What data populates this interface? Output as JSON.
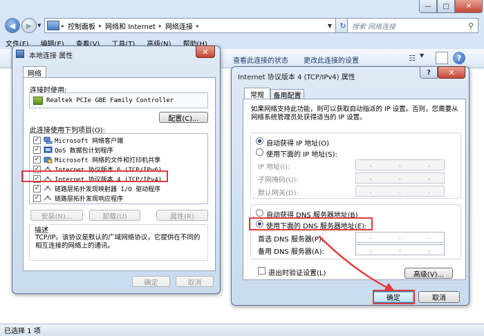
{
  "explorer": {
    "breadcrumb": [
      "控制面板",
      "网络和 Internet",
      "网络连接"
    ],
    "search_placeholder": "搜索 网络连接",
    "menu": [
      "文件(F)",
      "编辑(E)",
      "查看(V)",
      "工具(T)",
      "高级(N)",
      "帮助(H)"
    ],
    "commands": {
      "view_status": "查看此连接的状态",
      "change_settings": "更改此连接的设置"
    },
    "status": "已选择 1 项",
    "window_controls": {
      "minimize": "—",
      "maximize": "□",
      "close": "✕"
    }
  },
  "local_dialog": {
    "title": "本地连接 属性",
    "tab": "网络",
    "connect_using_label": "连接时使用:",
    "adapter": "Realtek PCIe GBE Family Controller",
    "configure_button": "配置(C)...",
    "items_label": "此连接使用下列项目(O):",
    "items": [
      {
        "label": "Microsoft 网络客户端",
        "checked": true,
        "icon": "network-client-icon"
      },
      {
        "label": "QoS 数据包计划程序",
        "checked": true,
        "icon": "qos-icon"
      },
      {
        "label": "Microsoft 网络的文件和打印机共享",
        "checked": true,
        "icon": "file-share-icon"
      },
      {
        "label": "Internet 协议版本 6 (TCP/IPv6)",
        "checked": true,
        "icon": "protocol-icon"
      },
      {
        "label": "Internet 协议版本 4 (TCP/IPv4)",
        "checked": true,
        "icon": "protocol-icon"
      },
      {
        "label": "链路层拓扑发现映射器 I/O 驱动程序",
        "checked": true,
        "icon": "protocol-icon"
      },
      {
        "label": "链路层拓扑发现响应程序",
        "checked": true,
        "icon": "protocol-icon"
      }
    ],
    "install_button": "安装(N)...",
    "uninstall_button": "卸载(U)",
    "properties_button": "属性(R)",
    "description_label": "描述",
    "description": "TCP/IP。该协议是默认的广域网络协议，它提供在不同的相互连接的网络上的通讯。",
    "ok_button": "确定",
    "cancel_button": "取消"
  },
  "ipv4_dialog": {
    "title": "Internet 协议版本 4 (TCP/IPv4) 属性",
    "tabs": {
      "general": "常规",
      "alternate": "备用配置"
    },
    "intro": "如果网络支持此功能，则可以获取自动指派的 IP 设置。否则，您需要从网络系统管理员处获得适当的 IP 设置。",
    "auto_ip": "自动获得 IP 地址(O)",
    "manual_ip": "使用下面的 IP 地址(S):",
    "ip_label": "IP 地址(I):",
    "mask_label": "子网掩码(U):",
    "gateway_label": "默认网关(D):",
    "auto_dns": "自动获得 DNS 服务器地址(B)",
    "manual_dns": "使用下面的 DNS 服务器地址(E):",
    "dns1_label": "首选 DNS 服务器(P):",
    "dns2_label": "备用 DNS 服务器(A):",
    "ip_dots": ".",
    "validate_label": "退出时验证设置(L)",
    "validate_checked": false,
    "advanced_button": "高级(V)...",
    "ok_button": "确定",
    "cancel_button": "取消",
    "help_glyph": "?",
    "close_glyph": "✕",
    "selected_ip_option": "auto",
    "selected_dns_option": "manual"
  },
  "colors": {
    "annotation": "#e23a3a",
    "accent": "#2d63b5"
  }
}
